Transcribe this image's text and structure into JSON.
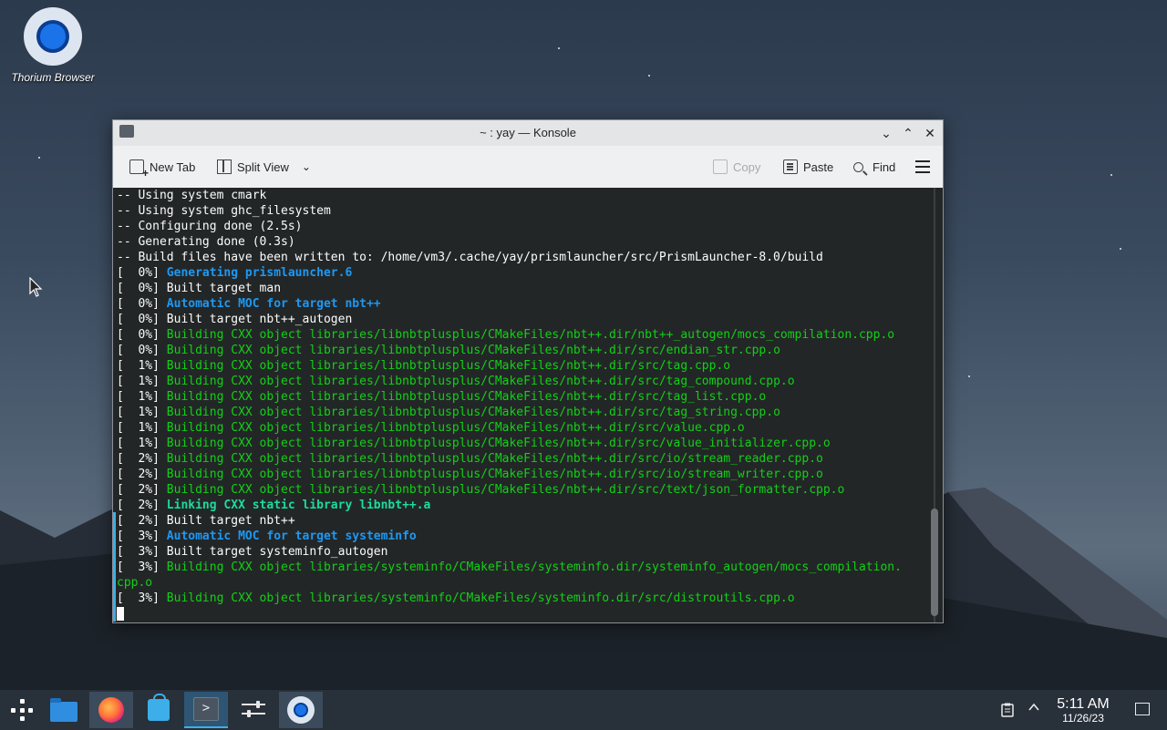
{
  "desktop": {
    "icons": [
      {
        "label": "Thorium Browser",
        "icon": "thorium-browser-icon"
      }
    ]
  },
  "window": {
    "title": "~ : yay — Konsole",
    "controls": [
      "minimize",
      "maximize",
      "close"
    ],
    "toolbar": {
      "new_tab": "New Tab",
      "split_view": "Split View",
      "copy": "Copy",
      "paste": "Paste",
      "find": "Find",
      "menu_icon": "hamburger-menu-icon"
    }
  },
  "terminal": {
    "lines": [
      {
        "prefix": "",
        "text": "-- Using system cmark",
        "style": "plain"
      },
      {
        "prefix": "",
        "text": "-- Using system ghc_filesystem",
        "style": "plain"
      },
      {
        "prefix": "",
        "text": "-- Configuring done (2.5s)",
        "style": "plain"
      },
      {
        "prefix": "",
        "text": "-- Generating done (0.3s)",
        "style": "plain"
      },
      {
        "prefix": "",
        "text": "-- Build files have been written to: /home/vm3/.cache/yay/prismlauncher/src/PrismLauncher-8.0/build",
        "style": "plain"
      },
      {
        "prefix": "[  0%] ",
        "text": "Generating prismlauncher.6",
        "style": "blue"
      },
      {
        "prefix": "[  0%] ",
        "text": "Built target man",
        "style": "plain"
      },
      {
        "prefix": "[  0%] ",
        "text": "Automatic MOC for target nbt++",
        "style": "blue"
      },
      {
        "prefix": "[  0%] ",
        "text": "Built target nbt++_autogen",
        "style": "plain"
      },
      {
        "prefix": "[  0%] ",
        "text": "Building CXX object libraries/libnbtplusplus/CMakeFiles/nbt++.dir/nbt++_autogen/mocs_compilation.cpp.o",
        "style": "build"
      },
      {
        "prefix": "[  0%] ",
        "text": "Building CXX object libraries/libnbtplusplus/CMakeFiles/nbt++.dir/src/endian_str.cpp.o",
        "style": "build"
      },
      {
        "prefix": "[  1%] ",
        "text": "Building CXX object libraries/libnbtplusplus/CMakeFiles/nbt++.dir/src/tag.cpp.o",
        "style": "build"
      },
      {
        "prefix": "[  1%] ",
        "text": "Building CXX object libraries/libnbtplusplus/CMakeFiles/nbt++.dir/src/tag_compound.cpp.o",
        "style": "build"
      },
      {
        "prefix": "[  1%] ",
        "text": "Building CXX object libraries/libnbtplusplus/CMakeFiles/nbt++.dir/src/tag_list.cpp.o",
        "style": "build"
      },
      {
        "prefix": "[  1%] ",
        "text": "Building CXX object libraries/libnbtplusplus/CMakeFiles/nbt++.dir/src/tag_string.cpp.o",
        "style": "build"
      },
      {
        "prefix": "[  1%] ",
        "text": "Building CXX object libraries/libnbtplusplus/CMakeFiles/nbt++.dir/src/value.cpp.o",
        "style": "build"
      },
      {
        "prefix": "[  1%] ",
        "text": "Building CXX object libraries/libnbtplusplus/CMakeFiles/nbt++.dir/src/value_initializer.cpp.o",
        "style": "build"
      },
      {
        "prefix": "[  2%] ",
        "text": "Building CXX object libraries/libnbtplusplus/CMakeFiles/nbt++.dir/src/io/stream_reader.cpp.o",
        "style": "build"
      },
      {
        "prefix": "[  2%] ",
        "text": "Building CXX object libraries/libnbtplusplus/CMakeFiles/nbt++.dir/src/io/stream_writer.cpp.o",
        "style": "build"
      },
      {
        "prefix": "[  2%] ",
        "text": "Building CXX object libraries/libnbtplusplus/CMakeFiles/nbt++.dir/src/text/json_formatter.cpp.o",
        "style": "build"
      },
      {
        "prefix": "[  2%] ",
        "text": "Linking CXX static library libnbt++.a",
        "style": "green"
      },
      {
        "prefix": "[  2%] ",
        "text": "Built target nbt++",
        "style": "plain"
      },
      {
        "prefix": "[  3%] ",
        "text": "Automatic MOC for target systeminfo",
        "style": "blue"
      },
      {
        "prefix": "[  3%] ",
        "text": "Built target systeminfo_autogen",
        "style": "plain"
      },
      {
        "prefix": "[  3%] ",
        "text": "Building CXX object libraries/systeminfo/CMakeFiles/systeminfo.dir/systeminfo_autogen/mocs_compilation.",
        "style": "build"
      },
      {
        "prefix": "",
        "text": "cpp.o",
        "style": "build"
      },
      {
        "prefix": "[  3%] ",
        "text": "Building CXX object libraries/systeminfo/CMakeFiles/systeminfo.dir/src/distroutils.cpp.o",
        "style": "build"
      }
    ]
  },
  "taskbar": {
    "items": [
      {
        "name": "application-launcher-icon"
      },
      {
        "name": "dolphin-file-manager-icon"
      },
      {
        "name": "firefox-icon"
      },
      {
        "name": "discover-store-icon"
      },
      {
        "name": "konsole-icon"
      },
      {
        "name": "system-settings-icon"
      },
      {
        "name": "thorium-browser-icon"
      }
    ],
    "clock": {
      "time": "5:11 AM",
      "date": "11/26/23"
    },
    "tray": [
      "clipboard-icon",
      "expand-tray-icon",
      "show-desktop-icon"
    ]
  }
}
